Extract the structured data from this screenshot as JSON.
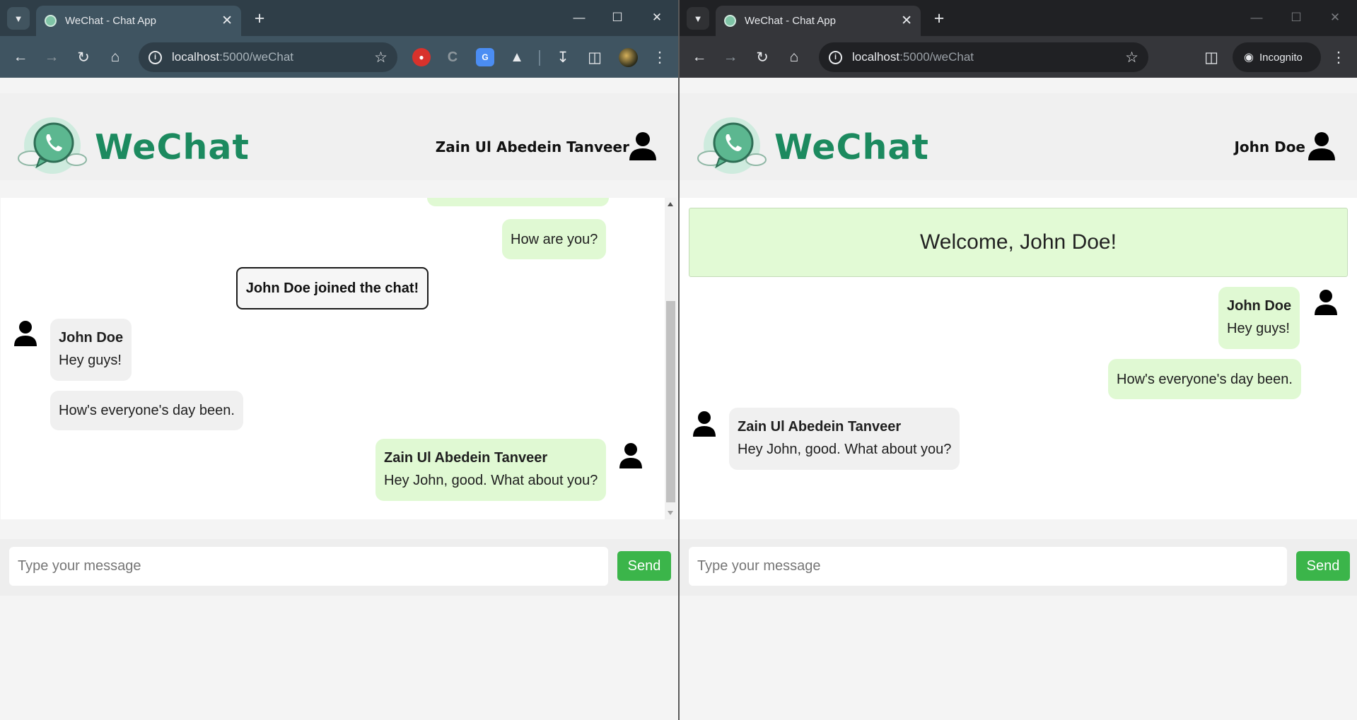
{
  "browser": {
    "tab_title": "WeChat - Chat App",
    "url_host": "localhost",
    "url_path": ":5000/weChat",
    "incognito_label": "Incognito"
  },
  "app": {
    "brand": "WeChat",
    "accent": "#1c8a5f",
    "sent_bubble_color": "#e0f9d3",
    "received_bubble_color": "#f0f0f0",
    "send_button_color": "#3bb54a"
  },
  "left": {
    "current_user": "Zain Ul Abedein Tanveer",
    "messages": [
      {
        "text": "How are you?"
      },
      {
        "notice": "John Doe joined the chat!"
      },
      {
        "sender": "John Doe",
        "text": "Hey guys!"
      },
      {
        "text": "How's everyone's day been."
      },
      {
        "sender": "Zain Ul Abedein Tanveer",
        "text": "Hey John, good. What about you?"
      }
    ],
    "composer": {
      "placeholder": "Type your message",
      "send_label": "Send"
    }
  },
  "right": {
    "current_user": "John Doe",
    "welcome": "Welcome, John Doe!",
    "messages": [
      {
        "sender": "John Doe",
        "text": "Hey guys!"
      },
      {
        "text": "How's everyone's day been."
      },
      {
        "sender": "Zain Ul Abedein Tanveer",
        "text": "Hey John, good. What about you?"
      }
    ],
    "composer": {
      "placeholder": "Type your message",
      "send_label": "Send"
    }
  }
}
